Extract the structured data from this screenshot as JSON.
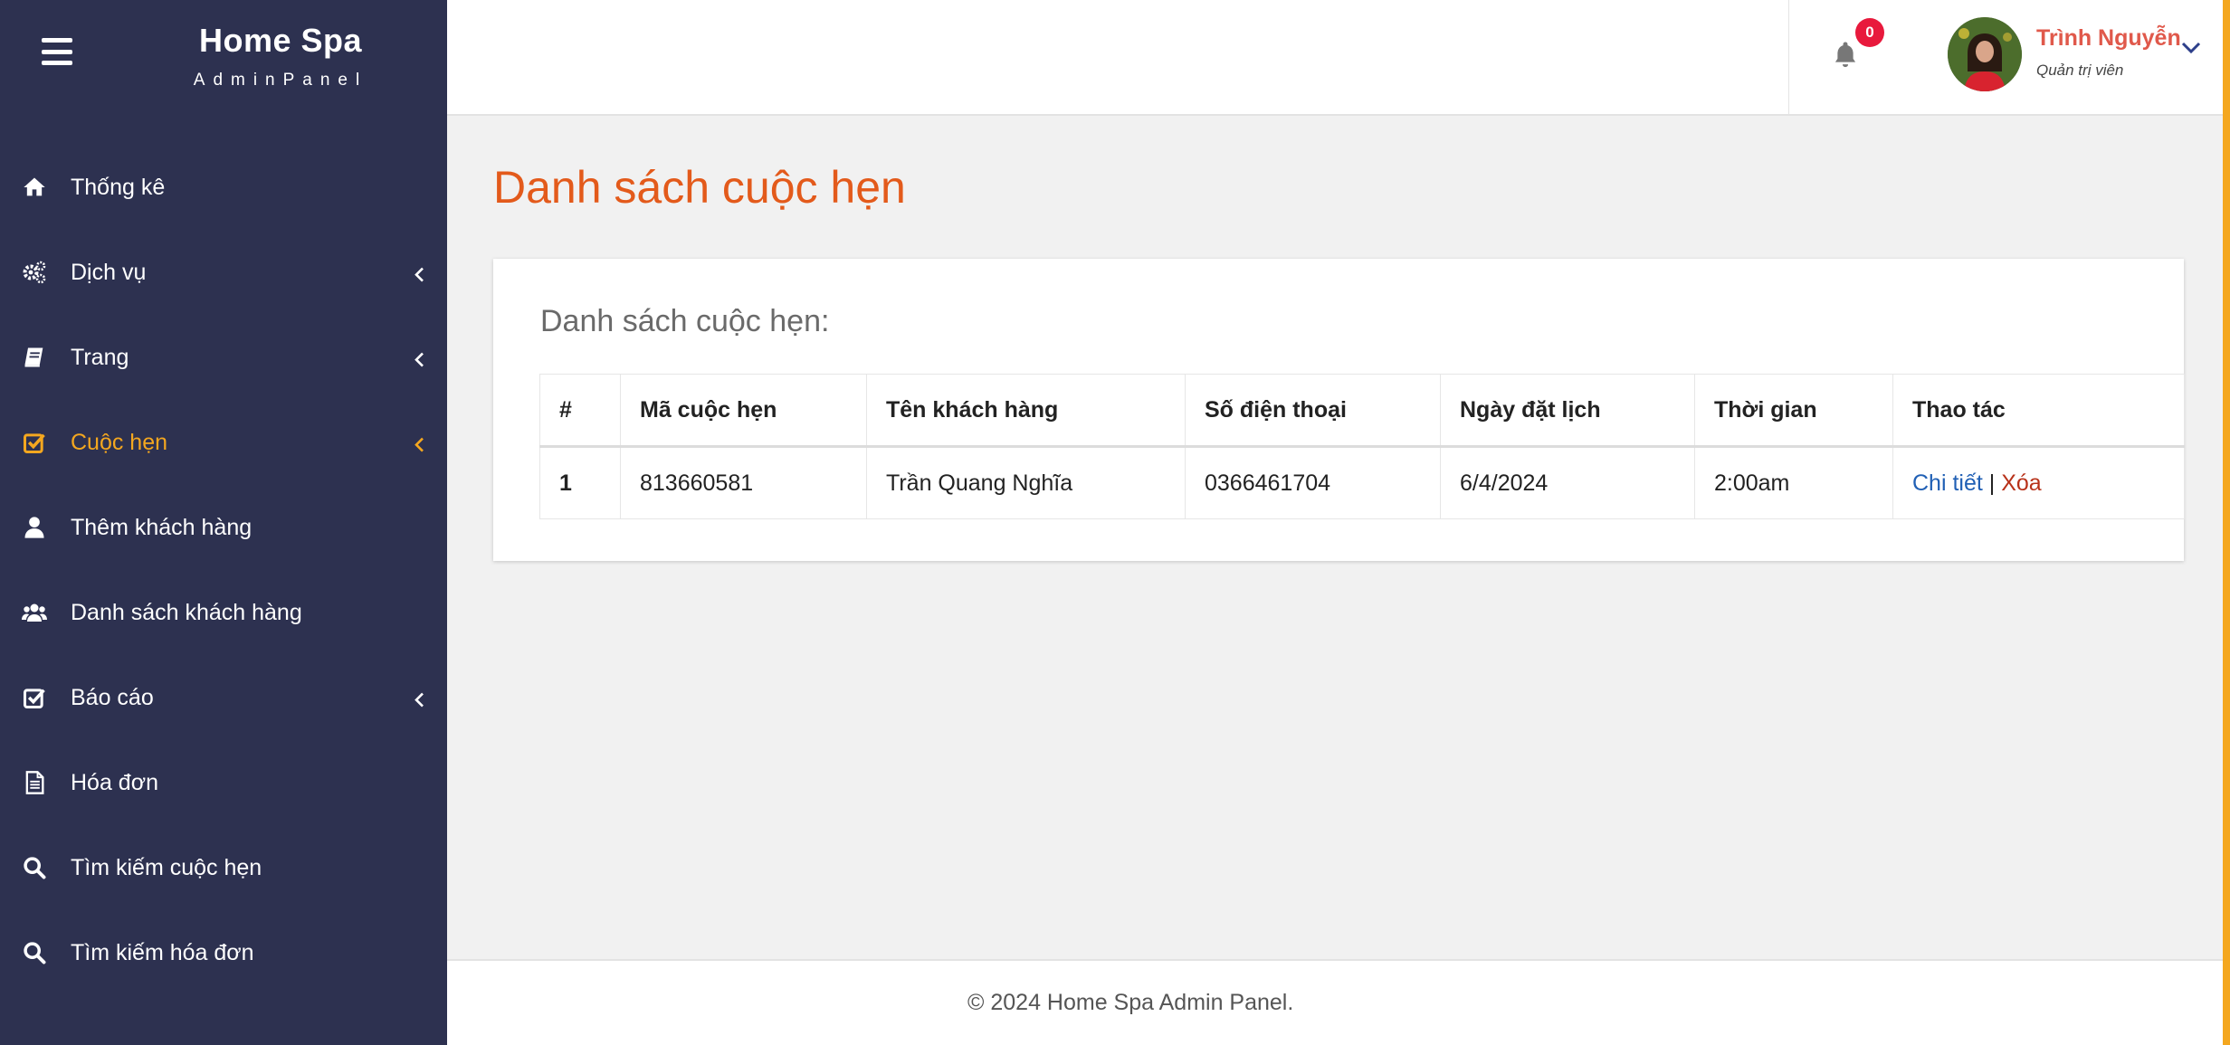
{
  "brand": {
    "title": "Home Spa",
    "subtitle": "AdminPanel"
  },
  "sidebar": {
    "items": [
      {
        "label": "Thống kê",
        "icon": "home-icon",
        "has_submenu": false
      },
      {
        "label": "Dịch vụ",
        "icon": "gears-icon",
        "has_submenu": true
      },
      {
        "label": "Trang",
        "icon": "book-icon",
        "has_submenu": true
      },
      {
        "label": "Cuộc hẹn",
        "icon": "check-square-icon",
        "has_submenu": true,
        "active": true
      },
      {
        "label": "Thêm khách hàng",
        "icon": "user-icon",
        "has_submenu": false
      },
      {
        "label": "Danh sách khách hàng",
        "icon": "users-icon",
        "has_submenu": false
      },
      {
        "label": "Báo cáo",
        "icon": "check-square-icon",
        "has_submenu": true
      },
      {
        "label": "Hóa đơn",
        "icon": "file-text-icon",
        "has_submenu": false
      },
      {
        "label": "Tìm kiếm cuộc hẹn",
        "icon": "search-icon",
        "has_submenu": false
      },
      {
        "label": "Tìm kiếm hóa đơn",
        "icon": "search-icon",
        "has_submenu": false
      }
    ]
  },
  "topbar": {
    "notification_count": "0",
    "user_name": "Trình Nguyễn",
    "user_role": "Quản trị viên"
  },
  "main": {
    "page_title": "Danh sách cuộc hẹn",
    "card_title": "Danh sách cuộc hẹn:",
    "table": {
      "headers": [
        "#",
        "Mã cuộc hẹn",
        "Tên khách hàng",
        "Số điện thoại",
        "Ngày đặt lịch",
        "Thời gian",
        "Thao tác"
      ],
      "rows": [
        {
          "index": "1",
          "code": "813660581",
          "customer": "Trần Quang Nghĩa",
          "phone": "0366461704",
          "date": "6/4/2024",
          "time": "2:00am",
          "action_detail": "Chi tiết",
          "action_separator": "|",
          "action_delete": "Xóa"
        }
      ]
    }
  },
  "footer": {
    "text": "© 2024 Home Spa Admin Panel."
  },
  "colors": {
    "sidebar_bg": "#2d3150",
    "active": "#f4a71f",
    "title": "#e35a1b",
    "user_name": "#e0594b",
    "badge": "#e8193c",
    "link_detail": "#2160b5",
    "link_delete": "#b8321a"
  }
}
